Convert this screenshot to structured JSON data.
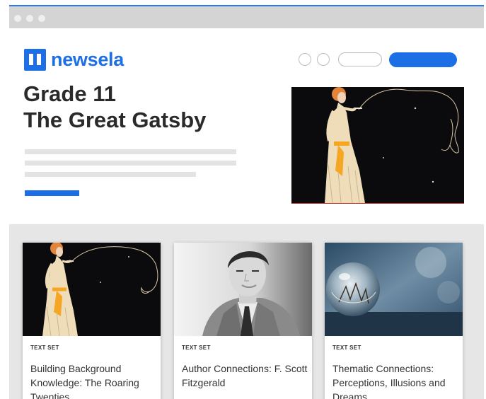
{
  "window": {
    "chrome_color": "#d4d4d4",
    "accent_line_color": "#2f7be5",
    "controls": [
      "window-dot",
      "window-dot",
      "window-dot"
    ]
  },
  "brand": {
    "logo_text": "newsela",
    "logo_icon": "newsela-logo-icon",
    "color": "#1d6fe5"
  },
  "header": {
    "title_line1": "Grade 11",
    "title_line2": "The Great Gatsby"
  },
  "hero_image": {
    "subject": "art deco illustration of a flapper woman smoking",
    "background": "#0b0b0d"
  },
  "cards": [
    {
      "kicker": "TEXT SET",
      "title": "Building Background Knowledge: The Roaring Twenties",
      "image": "art deco flapper illustration"
    },
    {
      "kicker": "TEXT SET",
      "title": "Author Connections: F. Scott Fitzgerald",
      "image": "black and white portrait photo"
    },
    {
      "kicker": "TEXT SET",
      "title": "Thematic Connections: Perceptions, Illusions and Dreams",
      "image": "glass sphere reflecting trees"
    }
  ]
}
